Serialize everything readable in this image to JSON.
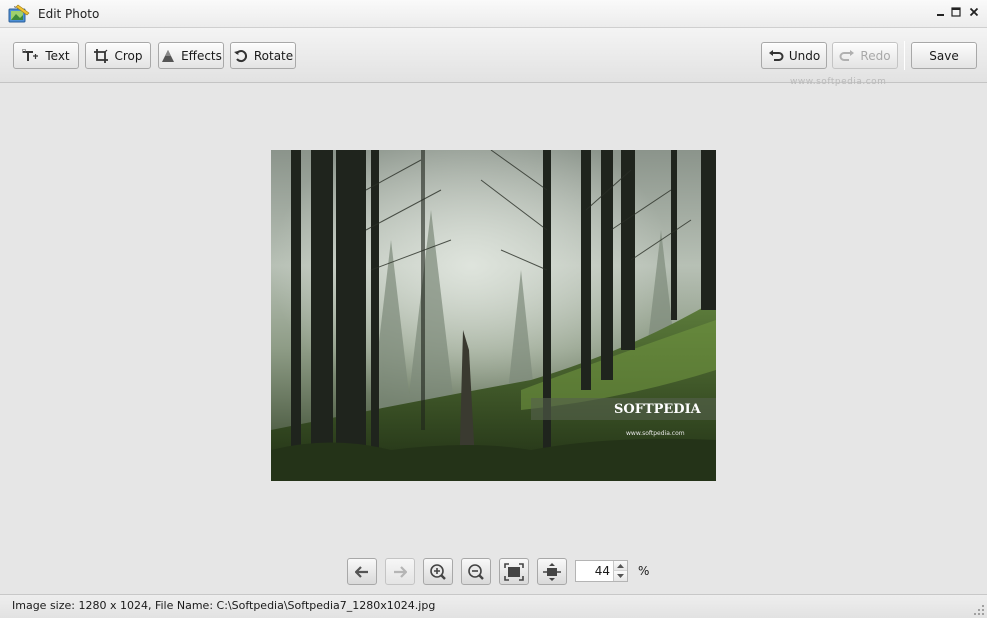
{
  "window": {
    "title": "Edit Photo",
    "app_icon": "photo-editor-icon",
    "controls": {
      "minimize": "minimize-icon",
      "maximize": "maximize-icon",
      "close": "close-icon"
    }
  },
  "toolbar": {
    "text_label": "Text",
    "crop_label": "Crop",
    "effects_label": "Effects",
    "rotate_label": "Rotate",
    "undo_label": "Undo",
    "redo_label": "Redo",
    "save_label": "Save"
  },
  "watermark": "www.softpedia.com",
  "photo": {
    "brand": "SOFTPEDIA",
    "url": "www.softpedia.com",
    "description_icon": "forest-photo"
  },
  "bottom_controls": {
    "previous": "arrow-left-icon",
    "next": "arrow-right-icon",
    "zoom_in": "zoom-in-icon",
    "zoom_out": "zoom-out-icon",
    "fit": "fit-to-window-icon",
    "actual_size": "actual-size-icon",
    "zoom_value": "44",
    "zoom_unit": "%"
  },
  "status": {
    "text": "Image size: 1280 x 1024, File Name: C:\\Softpedia\\Softpedia7_1280x1024.jpg"
  },
  "colors": {
    "window_bg": "#e6e6e6",
    "button_border": "#a8a8a8",
    "disabled_text": "#a8a8a8"
  }
}
